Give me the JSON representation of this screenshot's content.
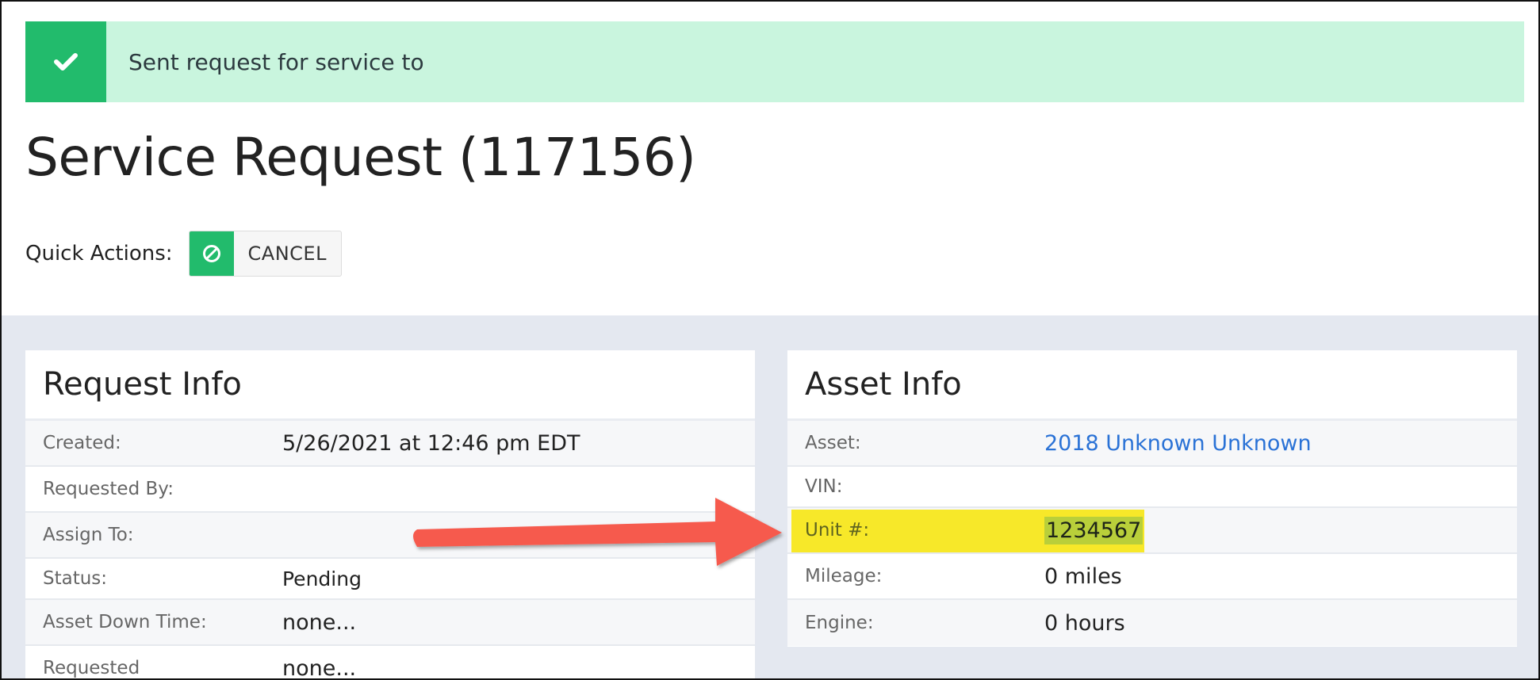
{
  "banner": {
    "message": "Sent request for service to",
    "icon": "check-icon",
    "color": "#22bb6c"
  },
  "page": {
    "title": "Service Request (117156)"
  },
  "quick_actions": {
    "label": "Quick Actions:",
    "cancel_label": "CANCEL",
    "cancel_icon": "ban-icon"
  },
  "request_info": {
    "title": "Request Info",
    "rows": [
      {
        "label": "Created:",
        "value": "5/26/2021 at 12:46 pm EDT"
      },
      {
        "label": "Requested By:",
        "value": ""
      },
      {
        "label": "Assign To:",
        "value": ""
      },
      {
        "label": "Status:",
        "value": "Pending"
      },
      {
        "label": "Asset Down Time:",
        "value": "none..."
      },
      {
        "label": "Requested",
        "value": "none..."
      }
    ]
  },
  "asset_info": {
    "title": "Asset Info",
    "rows": [
      {
        "label": "Asset:",
        "value": "2018 Unknown Unknown"
      },
      {
        "label": "VIN:",
        "value": ""
      },
      {
        "label": "Unit #:",
        "value": "1234567"
      },
      {
        "label": "Mileage:",
        "value": "0 miles"
      },
      {
        "label": "Engine:",
        "value": "0 hours"
      }
    ]
  },
  "colors": {
    "success_bg": "#c9f5de",
    "success_accent": "#22bb6c",
    "highlight": "#f7e829",
    "arrow": "#f65a4e",
    "link": "#2a72d6"
  }
}
